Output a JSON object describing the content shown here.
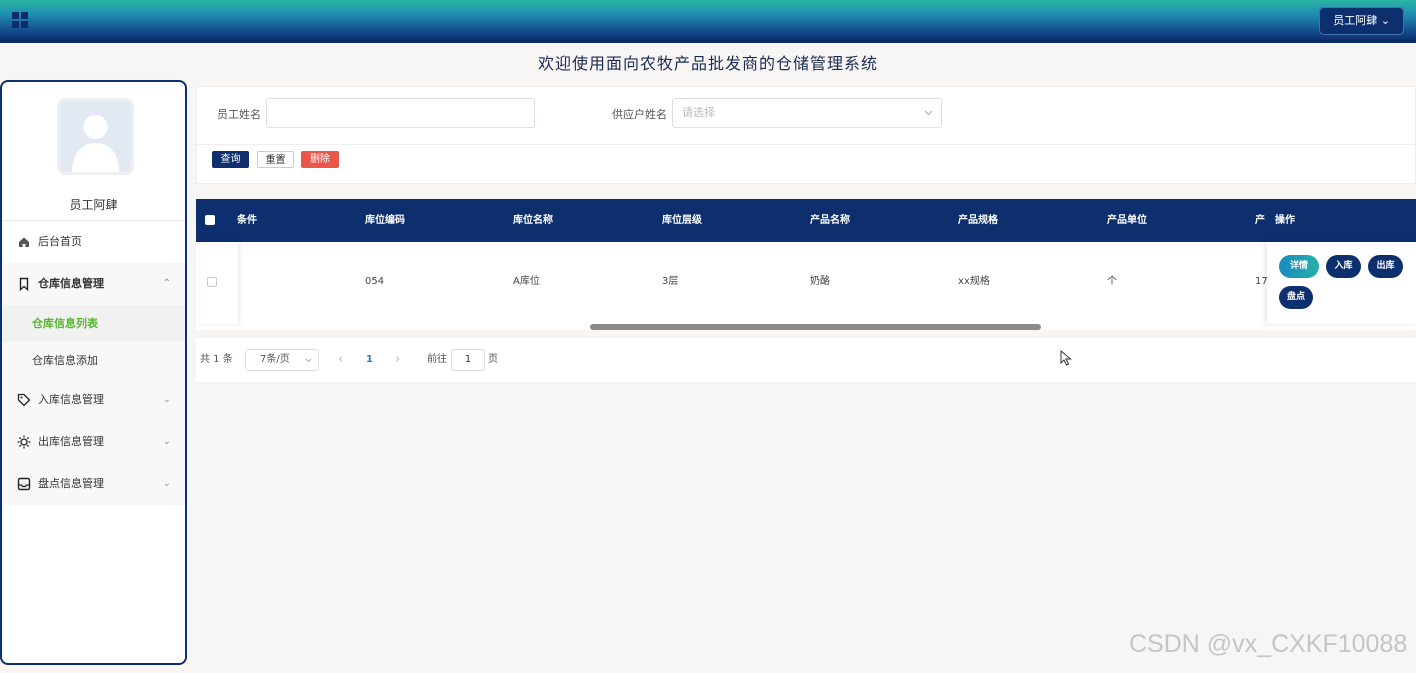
{
  "topbar": {
    "user_menu_label": "员工阿肆 ⌄"
  },
  "page_title": "欢迎使用面向农牧产品批发商的仓储管理系统",
  "sidebar": {
    "user_name": "员工阿肆",
    "items": [
      {
        "label": "后台首页",
        "icon": "home-icon"
      },
      {
        "label": "仓库信息管理",
        "icon": "bookmark-icon",
        "chevron": "⌃"
      },
      {
        "label": "入库信息管理",
        "icon": "tag-icon",
        "chevron": "⌄"
      },
      {
        "label": "出库信息管理",
        "icon": "sun-icon",
        "chevron": "⌄"
      },
      {
        "label": "盘点信息管理",
        "icon": "inbox-icon",
        "chevron": "⌄"
      }
    ],
    "sub_items": [
      {
        "label": "仓库信息列表",
        "active": true
      },
      {
        "label": "仓库信息添加",
        "active": false
      }
    ]
  },
  "search": {
    "employee_label": "员工姓名",
    "employee_value": "",
    "supplier_label": "供应户姓名",
    "supplier_placeholder": "请选择",
    "query_label": "查询",
    "reset_label": "重置",
    "delete_label": "删除"
  },
  "table": {
    "headers": [
      "条件",
      "库位编码",
      "库位名称",
      "库位层级",
      "产品名称",
      "产品规格",
      "产品单位",
      "产",
      "操作"
    ],
    "rows": [
      {
        "cond": "",
        "code": "054",
        "name": "A库位",
        "level": "3层",
        "product": "奶酪",
        "spec": "xx规格",
        "unit": "个",
        "partial": "17"
      }
    ],
    "actions": {
      "detail": "详情",
      "in": "入库",
      "out": "出库",
      "check": "盘点"
    }
  },
  "pagination": {
    "total": "共 1 条",
    "page_size": "7条/页",
    "prev": "‹",
    "current": "1",
    "next": "›",
    "goto_label": "前往",
    "goto_value": "1",
    "page_suffix": "页"
  },
  "watermark": "CSDN @vx_CXKF10088",
  "colors": {
    "primary": "#0d2f6e",
    "active_menu": "#59b531",
    "danger": "#e9574a"
  }
}
